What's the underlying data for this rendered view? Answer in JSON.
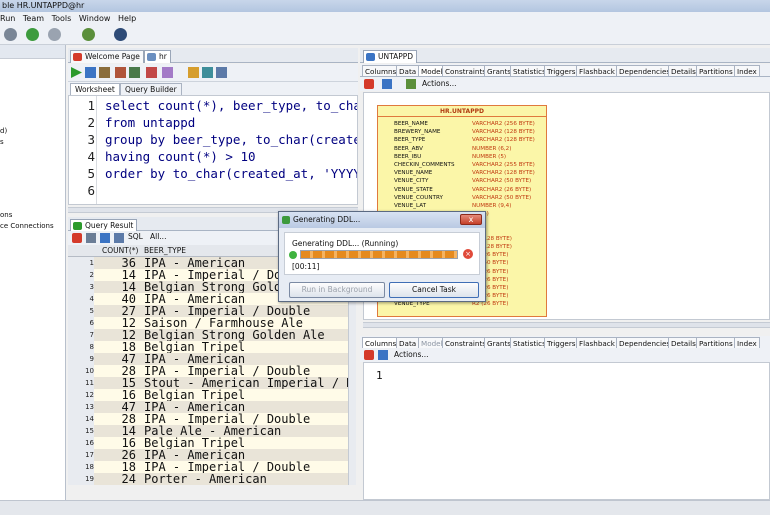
{
  "window": {
    "title": "ble HR.UNTAPPD@hr"
  },
  "menu": [
    "Run",
    "Team",
    "Tools",
    "Window",
    "Help"
  ],
  "menu_labels": {
    "run": "Run",
    "team": "Team",
    "tools": "Tools",
    "window": "Window",
    "help": "Help"
  },
  "left_panel": {
    "items": [
      "d)",
      "s",
      "ons",
      "ce Connections"
    ]
  },
  "editor_tabs": {
    "welcome": "Welcome Page",
    "hr": "hr"
  },
  "worksheet_tabs": {
    "worksheet": "Worksheet",
    "query_builder": "Query Builder"
  },
  "editor": {
    "lines": [
      {
        "n": "1",
        "code": "select count(*), beer_type, to_char("
      },
      {
        "n": "2",
        "code": "from untappd"
      },
      {
        "n": "3",
        "code": "group by beer_type, to_char(created_"
      },
      {
        "n": "4",
        "code": "having count(*) > 10"
      },
      {
        "n": "5",
        "code": "order by to_char(created_at, 'YYYY')"
      },
      {
        "n": "6",
        "code": ""
      }
    ]
  },
  "query_result": {
    "tab": "Query Result",
    "toolbar_sql": "SQL",
    "toolbar_all": "All...",
    "col_count": "COUNT(*)",
    "col_beer_type": "BEER_TYPE",
    "rows": [
      {
        "n": "1",
        "count": "36",
        "beer_type": "IPA - American"
      },
      {
        "n": "2",
        "count": "14",
        "beer_type": "IPA - Imperial / Double"
      },
      {
        "n": "3",
        "count": "14",
        "beer_type": "Belgian Strong Golden Ale"
      },
      {
        "n": "4",
        "count": "40",
        "beer_type": "IPA - American"
      },
      {
        "n": "5",
        "count": "27",
        "beer_type": "IPA - Imperial / Double"
      },
      {
        "n": "6",
        "count": "12",
        "beer_type": "Saison / Farmhouse Ale"
      },
      {
        "n": "7",
        "count": "12",
        "beer_type": "Belgian Strong Golden Ale"
      },
      {
        "n": "8",
        "count": "18",
        "beer_type": "Belgian Tripel"
      },
      {
        "n": "9",
        "count": "47",
        "beer_type": "IPA - American"
      },
      {
        "n": "10",
        "count": "28",
        "beer_type": "IPA - Imperial / Double"
      },
      {
        "n": "11",
        "count": "15",
        "beer_type": "Stout - American Imperial / Do"
      },
      {
        "n": "12",
        "count": "16",
        "beer_type": "Belgian Tripel"
      },
      {
        "n": "13",
        "count": "47",
        "beer_type": "IPA - American"
      },
      {
        "n": "14",
        "count": "28",
        "beer_type": "IPA - Imperial / Double"
      },
      {
        "n": "15",
        "count": "14",
        "beer_type": "Pale Ale - American"
      },
      {
        "n": "16",
        "count": "16",
        "beer_type": "Belgian Tripel"
      },
      {
        "n": "17",
        "count": "26",
        "beer_type": "IPA - American"
      },
      {
        "n": "18",
        "count": "18",
        "beer_type": "IPA - Imperial / Double"
      },
      {
        "n": "19",
        "count": "24",
        "beer_type": "Porter - American"
      }
    ]
  },
  "right_panel": {
    "tab": "UNTAPPD",
    "subtabs": [
      "Columns",
      "Data",
      "Model",
      "Constraints",
      "Grants",
      "Statistics",
      "Triggers",
      "Flashback",
      "Dependencies",
      "Details",
      "Partitions",
      "Index"
    ],
    "actions": "Actions...",
    "table_name": "HR.UNTAPPD",
    "columns": [
      {
        "name": "BEER_NAME",
        "type": "VARCHAR2 (256 BYTE)"
      },
      {
        "name": "BREWERY_NAME",
        "type": "VARCHAR2 (128 BYTE)"
      },
      {
        "name": "BEER_TYPE",
        "type": "VARCHAR2 (128 BYTE)"
      },
      {
        "name": "BEER_ABV",
        "type": "NUMBER (6,2)"
      },
      {
        "name": "BEER_IBU",
        "type": "NUMBER (5)"
      },
      {
        "name": "CHECKIN_COMMENTS",
        "type": "VARCHAR2 (255 BYTE)"
      },
      {
        "name": "VENUE_NAME",
        "type": "VARCHAR2 (128 BYTE)"
      },
      {
        "name": "VENUE_CITY",
        "type": "VARCHAR2 (50 BYTE)"
      },
      {
        "name": "VENUE_STATE",
        "type": "VARCHAR2 (26 BYTE)"
      },
      {
        "name": "VENUE_COUNTRY",
        "type": "VARCHAR2 (50 BYTE)"
      },
      {
        "name": "VENUE_LAT",
        "type": "NUMBER (9,4)"
      },
      {
        "name": "",
        "type": "(12,4)"
      },
      {
        "name": "",
        "type": "(4,2)"
      },
      {
        "name": "",
        "type": ""
      },
      {
        "name": "",
        "type": "R2 (128 BYTE)"
      },
      {
        "name": "",
        "type": "R2 (128 BYTE)"
      },
      {
        "name": "",
        "type": "R2 (26 BYTE)"
      },
      {
        "name": "",
        "type": "R2 (50 BYTE)"
      },
      {
        "name": "",
        "type": "R2 (26 BYTE)"
      },
      {
        "name": "",
        "type": "R2 (26 BYTE)"
      },
      {
        "name": "",
        "type": "R2 (26 BYTE)"
      },
      {
        "name": "",
        "type": "R2 (26 BYTE)"
      },
      {
        "name": "VENUE_TYPE",
        "type": "R2 (26 BYTE)"
      }
    ],
    "lower_subtabs": [
      "Columns",
      "Data",
      "Model",
      "Constraints",
      "Grants",
      "Statistics",
      "Triggers",
      "Flashback",
      "Dependencies",
      "Details",
      "Partitions",
      "Index"
    ],
    "lower_actions": "Actions...",
    "lower_line": "1"
  },
  "dialog": {
    "title": "Generating DDL...",
    "status": "Generating DDL... (Running)",
    "elapsed": "[00:11]",
    "progress": 1.0,
    "run_background": "Run in Background",
    "cancel": "Cancel Task",
    "close": "x"
  },
  "colors": {
    "accent": "#e58a1e",
    "model_table_fill": "#fbf6a8",
    "model_table_border": "#e0793d",
    "sql_keyword": "#000080"
  }
}
